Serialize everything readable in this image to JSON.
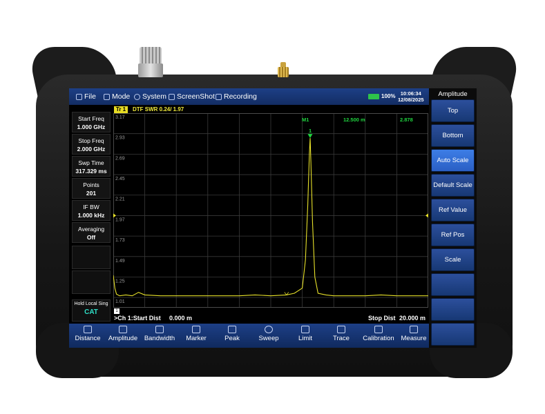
{
  "topbar": {
    "menu": [
      {
        "label": "File",
        "icon": "file-icon"
      },
      {
        "label": "Mode",
        "icon": "mode-icon"
      },
      {
        "label": "System",
        "icon": "gear-icon"
      },
      {
        "label": "ScreenShot",
        "icon": "camera-icon"
      },
      {
        "label": "Recording",
        "icon": "recording-icon"
      }
    ],
    "battery_pct": "100%",
    "time": "10:06:34",
    "date": "12/08/2025"
  },
  "softkeys": {
    "title": "Amplitude",
    "items": [
      "Top",
      "Bottom",
      "Auto Scale",
      "Default Scale",
      "Ref Value",
      "Ref Pos",
      "Scale",
      "",
      "",
      ""
    ],
    "active_index": 2
  },
  "params": [
    {
      "label": "Start Freq",
      "value": "1.000 GHz"
    },
    {
      "label": "Stop Freq",
      "value": "2.000 GHz"
    },
    {
      "label": "Swp Time",
      "value": "317.329 ms"
    },
    {
      "label": "Points",
      "value": "201"
    },
    {
      "label": "IF BW",
      "value": "1.000 kHz"
    },
    {
      "label": "Averaging",
      "value": "Off"
    }
  ],
  "hold": {
    "label": "Hold Local Sing",
    "value": "CAT"
  },
  "trace": {
    "tag": "Tr 1",
    "text": "DTF SWR 0.24/ 1.97"
  },
  "marker": {
    "name": "M1",
    "position": "12.500 m",
    "value": "2.878",
    "index_label": "1"
  },
  "readout": {
    "channel_badge": "1",
    "start_label": ">Ch 1:Start Dist",
    "start_value": "0.000 m",
    "stop_label": "Stop Dist",
    "stop_value": "20.000 m"
  },
  "bottom_menu": [
    "Distance",
    "Amplitude",
    "Bandwidth",
    "Marker",
    "Peak",
    "Sweep",
    "Limit",
    "Trace",
    "Calibration",
    "Measure"
  ],
  "colors": {
    "trace": "#e8e22a",
    "marker": "#20d640",
    "bar_blue": "#1d3f86",
    "active_key": "#3d7ee6"
  },
  "chart_data": {
    "type": "line",
    "title": "DTF SWR 0.24/ 1.97",
    "xlabel": "",
    "ylabel": "",
    "xlim": [
      0,
      20
    ],
    "ylim": [
      0.89,
      3.17
    ],
    "y_ticks": [
      3.17,
      2.93,
      2.69,
      2.45,
      2.21,
      1.97,
      1.73,
      1.49,
      1.25,
      1.01
    ],
    "grid": true,
    "series": [
      {
        "x": [
          0,
          0.1,
          0.2,
          0.4,
          0.8,
          1.2,
          1.6,
          2,
          3,
          4,
          5,
          6,
          7,
          8,
          9,
          10,
          11,
          11.5,
          12,
          12.2,
          12.35,
          12.45,
          12.5,
          12.55,
          12.65,
          12.8,
          13,
          13.5,
          14,
          15,
          16,
          17,
          18,
          19,
          20
        ],
        "y": [
          1.27,
          1.12,
          1.05,
          1.03,
          1.04,
          1.03,
          1.07,
          1.04,
          1.03,
          1.03,
          1.03,
          1.03,
          1.03,
          1.03,
          1.04,
          1.03,
          1.04,
          1.06,
          1.12,
          1.45,
          2.1,
          2.7,
          2.878,
          2.6,
          1.9,
          1.25,
          1.06,
          1.04,
          1.03,
          1.03,
          1.03,
          1.04,
          1.03,
          1.03,
          1.03
        ]
      }
    ],
    "markers": [
      {
        "name": "M1",
        "x": 12.5,
        "y": 2.878
      }
    ],
    "ref_level": 1.97
  }
}
